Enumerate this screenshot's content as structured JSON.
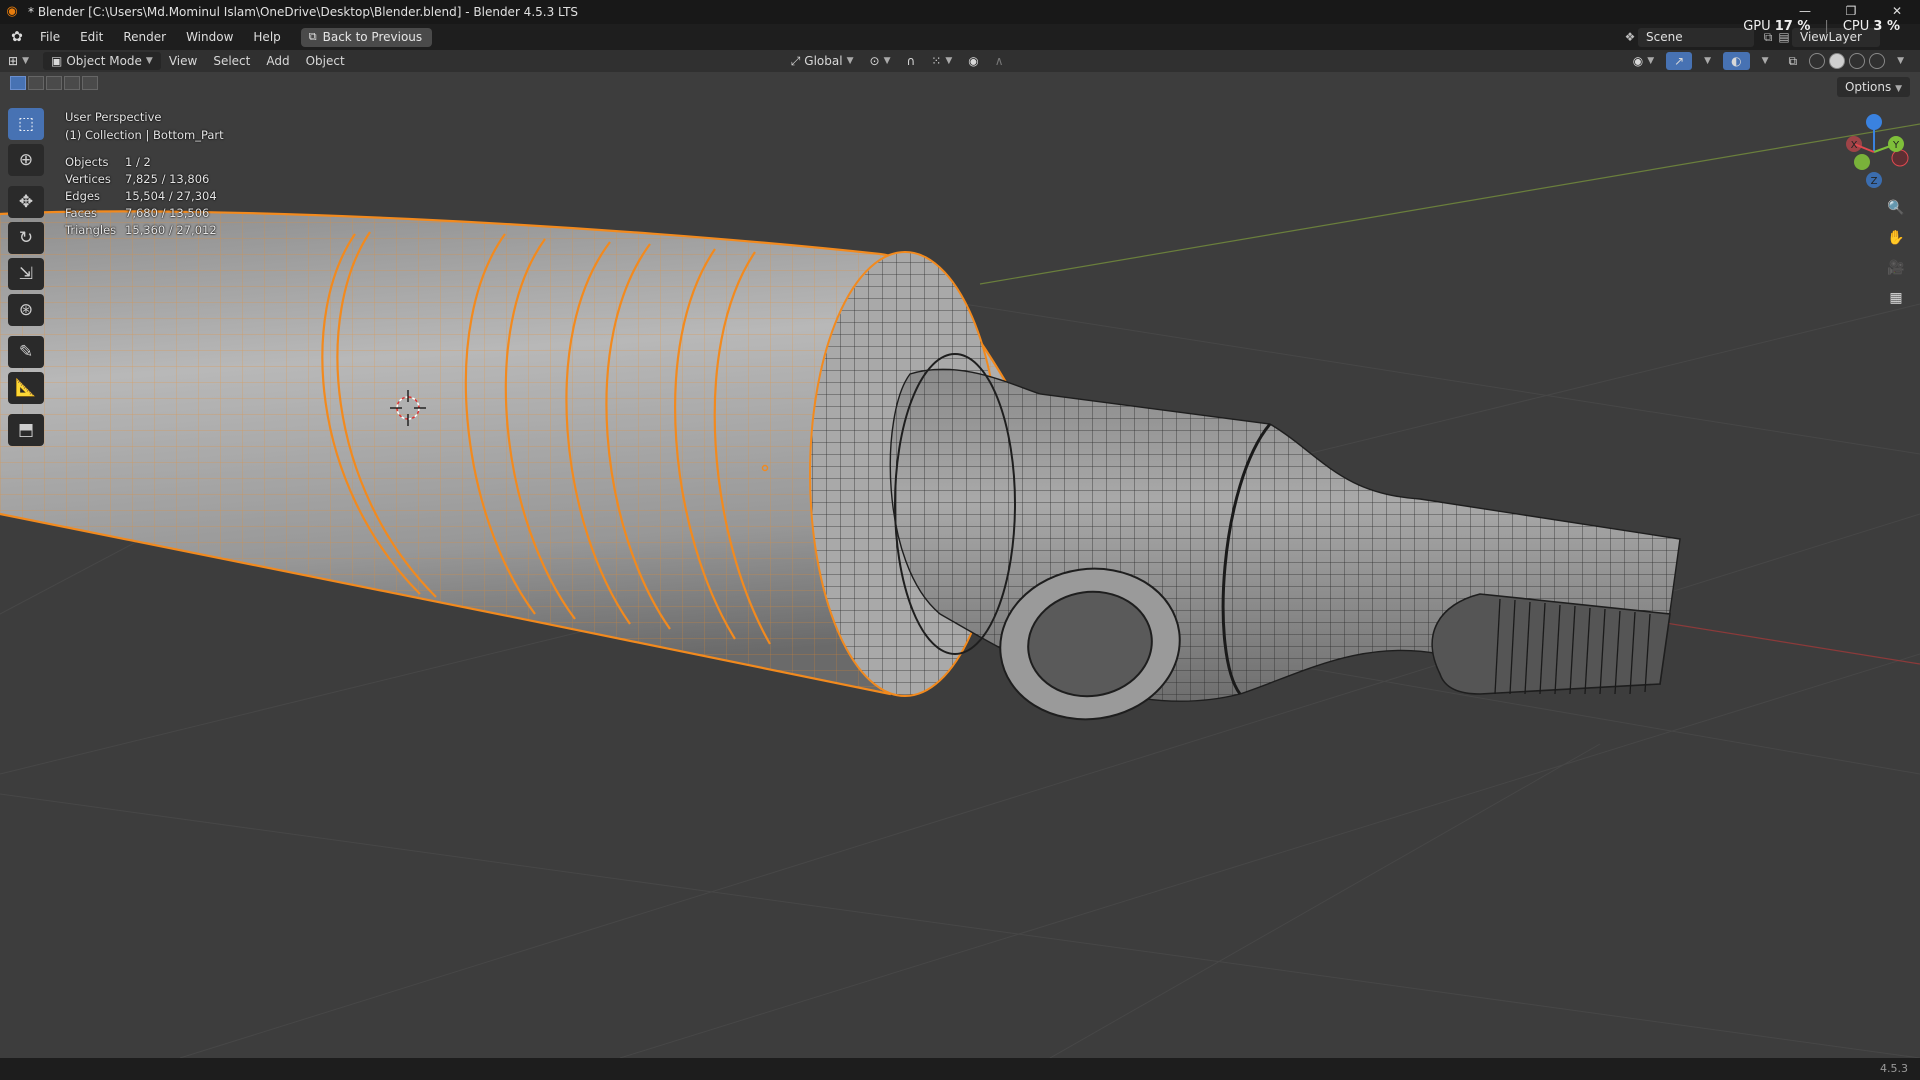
{
  "window": {
    "title": "* Blender [C:\\Users\\Md.Mominul Islam\\OneDrive\\Desktop\\Blender.blend] - Blender 4.5.3 LTS",
    "minimize": "—",
    "maximize": "❐",
    "close": "✕"
  },
  "system": {
    "gpu_label": "GPU",
    "gpu_value": "17 %",
    "cpu_label": "CPU",
    "cpu_value": "3 %"
  },
  "menu": {
    "items": [
      "File",
      "Edit",
      "Render",
      "Window",
      "Help"
    ],
    "back_button": "Back to Previous",
    "scene": "Scene",
    "view_layer": "ViewLayer"
  },
  "viewport_header": {
    "mode": "Object Mode",
    "menus": [
      "View",
      "Select",
      "Add",
      "Object"
    ],
    "orientation": "Global"
  },
  "tool_settings": {
    "options": "Options"
  },
  "overlay": {
    "perspective": "User Perspective",
    "collection": "(1) Collection | Bottom_Part",
    "stats": [
      {
        "label": "Objects",
        "value": "1 / 2"
      },
      {
        "label": "Vertices",
        "value": "7,825 / 13,806"
      },
      {
        "label": "Edges",
        "value": "15,504 / 27,304"
      },
      {
        "label": "Faces",
        "value": "7,680 / 13,506"
      },
      {
        "label": "Triangles",
        "value": "15,360 / 27,012"
      }
    ]
  },
  "gizmo": {
    "x": "X",
    "y": "Y",
    "z": "Z"
  },
  "status": {
    "version": "4.5.3"
  },
  "colors": {
    "selection": "#f28a1e",
    "active_tool": "#4772b3",
    "viewport_bg": "#3d3d3d",
    "axis_x": "#e0484f",
    "axis_y": "#7fbf3a",
    "axis_z": "#3a82e0"
  },
  "icons": {
    "app": "blender-logo-icon",
    "tools": [
      "select-box-icon",
      "cursor-icon",
      "move-icon",
      "rotate-icon",
      "scale-icon",
      "transform-icon",
      "annotate-icon",
      "measure-icon",
      "add-cube-icon"
    ],
    "nav": [
      "zoom-icon",
      "hand-pan-icon",
      "camera-icon",
      "grid-ortho-icon"
    ]
  }
}
